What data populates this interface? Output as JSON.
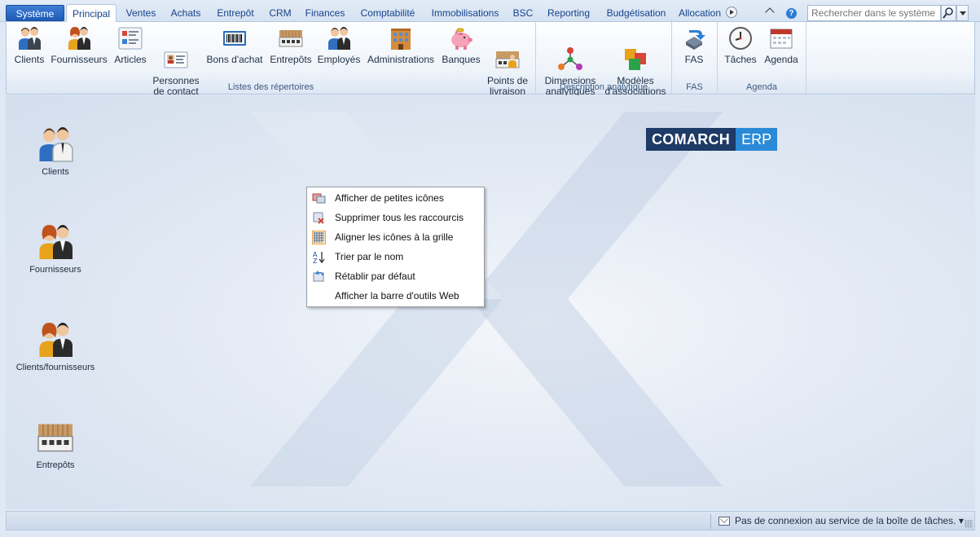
{
  "tabs": [
    {
      "label": "Système",
      "kind": "system"
    },
    {
      "label": "Principal",
      "kind": "active"
    },
    {
      "label": "Ventes"
    },
    {
      "label": "Achats"
    },
    {
      "label": "Entrepôt"
    },
    {
      "label": "CRM"
    },
    {
      "label": "Finances"
    },
    {
      "label": "Comptabilité"
    },
    {
      "label": "Immobilisations"
    },
    {
      "label": "BSC"
    },
    {
      "label": "Reporting"
    },
    {
      "label": "Budgétisation"
    },
    {
      "label": "Allocation"
    }
  ],
  "search": {
    "placeholder": "Rechercher dans le système"
  },
  "ribbon": {
    "groups": [
      {
        "label": "Listes des répertoires",
        "buttons": [
          {
            "label": "Clients",
            "icon": "clients-icon"
          },
          {
            "label": "Fournisseurs",
            "icon": "suppliers-icon"
          },
          {
            "label": "Articles",
            "icon": "articles-icon"
          },
          {
            "label": "Personnes\nde contact",
            "icon": "contact-card-icon"
          },
          {
            "label": "Bons d'achat",
            "icon": "voucher-icon"
          },
          {
            "label": "Entrepôts",
            "icon": "warehouse-icon"
          },
          {
            "label": "Employés",
            "icon": "employees-icon"
          },
          {
            "label": "Administrations",
            "icon": "building-icon"
          },
          {
            "label": "Banques",
            "icon": "piggy-bank-icon"
          },
          {
            "label": "Points de\nlivraison",
            "icon": "delivery-point-icon"
          }
        ]
      },
      {
        "label": "Description analytique",
        "buttons": [
          {
            "label": "Dimensions\nanalytiques",
            "icon": "dimensions-icon"
          },
          {
            "label": "Modèles\nd'associations",
            "icon": "association-models-icon"
          }
        ]
      },
      {
        "label": "FAS",
        "buttons": [
          {
            "label": "FAS",
            "icon": "fas-icon"
          }
        ]
      },
      {
        "label": "Agenda",
        "buttons": [
          {
            "label": "Tâches",
            "icon": "clock-icon"
          },
          {
            "label": "Agenda",
            "icon": "calendar-icon"
          }
        ]
      }
    ]
  },
  "desktop": {
    "shortcuts": [
      {
        "label": "Clients",
        "icon": "clients-icon"
      },
      {
        "label": "Fournisseurs",
        "icon": "suppliers-icon"
      },
      {
        "label": "Clients/fournisseurs",
        "icon": "clients-suppliers-icon"
      },
      {
        "label": "Entrepôts",
        "icon": "warehouse-icon"
      }
    ],
    "logo": {
      "part1": "COMARCH",
      "part2": "ERP"
    }
  },
  "context_menu": {
    "items": [
      {
        "label": "Afficher de petites icônes",
        "icon": "small-icons-icon"
      },
      {
        "label": "Supprimer tous les raccourcis",
        "icon": "delete-shortcuts-icon"
      },
      {
        "label": "Aligner les icônes à la grille",
        "icon": "grid-icon"
      },
      {
        "label": "Trier par le nom",
        "icon": "sort-az-icon"
      },
      {
        "label": "Rétablir par défaut",
        "icon": "restore-icon"
      },
      {
        "label": "Afficher la barre d'outils Web",
        "icon": ""
      }
    ]
  },
  "statusbar": {
    "text": "Pas de connexion au service de la boîte de tâches. ▾"
  },
  "colors": {
    "accent": "#1d5bb5",
    "ribbon_bg": "#eef3fa",
    "desktop_bg": "#dfe9f5",
    "logo_dark": "#1e3a66",
    "logo_light": "#2a8ad8"
  }
}
